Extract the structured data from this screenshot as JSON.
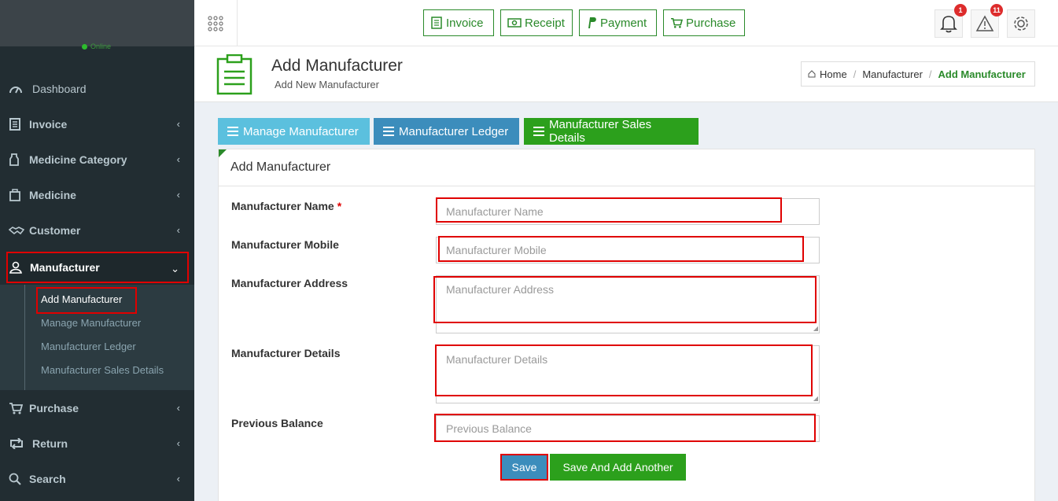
{
  "sidebar": {
    "status": "Online",
    "items": [
      {
        "label": "Dashboard",
        "icon": "dashboard-icon"
      },
      {
        "label": "Invoice",
        "icon": "invoice-icon"
      },
      {
        "label": "Medicine Category",
        "icon": "medicine-category-icon"
      },
      {
        "label": "Medicine",
        "icon": "medicine-icon"
      },
      {
        "label": "Customer",
        "icon": "handshake-icon"
      },
      {
        "label": "Manufacturer",
        "icon": "user-icon"
      },
      {
        "label": "Purchase",
        "icon": "cart-icon"
      },
      {
        "label": "Return",
        "icon": "retweet-icon"
      },
      {
        "label": "Search",
        "icon": "search-icon"
      }
    ],
    "submenu": [
      {
        "label": "Add Manufacturer"
      },
      {
        "label": "Manage Manufacturer"
      },
      {
        "label": "Manufacturer Ledger"
      },
      {
        "label": "Manufacturer Sales Details"
      }
    ]
  },
  "topbar": {
    "buttons": [
      {
        "label": "Invoice",
        "icon": "invoice-icon"
      },
      {
        "label": "Receipt",
        "icon": "money-icon"
      },
      {
        "label": "Payment",
        "icon": "paypal-icon"
      },
      {
        "label": "Purchase",
        "icon": "cart-icon"
      }
    ],
    "notifications_count": "1",
    "alerts_count": "11"
  },
  "header": {
    "title": "Add Manufacturer",
    "subtitle": "Add New Manufacturer",
    "breadcrumb": [
      "Home",
      "Manufacturer",
      "Add Manufacturer"
    ]
  },
  "tabs": [
    {
      "label": "Manage Manufacturer",
      "color": "#5bc0de"
    },
    {
      "label": "Manufacturer Ledger",
      "color": "#3c8dbc"
    },
    {
      "label": "Manufacturer Sales Details",
      "color": "#2ca01c"
    }
  ],
  "form": {
    "heading": "Add Manufacturer",
    "fields": [
      {
        "label": "Manufacturer Name",
        "placeholder": "Manufacturer  Name",
        "required": "*"
      },
      {
        "label": "Manufacturer Mobile",
        "placeholder": "Manufacturer  Mobile"
      },
      {
        "label": "Manufacturer Address",
        "placeholder": "Manufacturer  Address"
      },
      {
        "label": "Manufacturer Details",
        "placeholder": "Manufacturer Details"
      },
      {
        "label": "Previous Balance",
        "placeholder": "Previous Balance"
      }
    ],
    "save_label": "Save",
    "save_another_label": "Save And Add Another"
  },
  "colors": {
    "accent_green": "#2a8a2a",
    "highlight_red": "#e00000",
    "sidebar_bg": "#222d32"
  }
}
